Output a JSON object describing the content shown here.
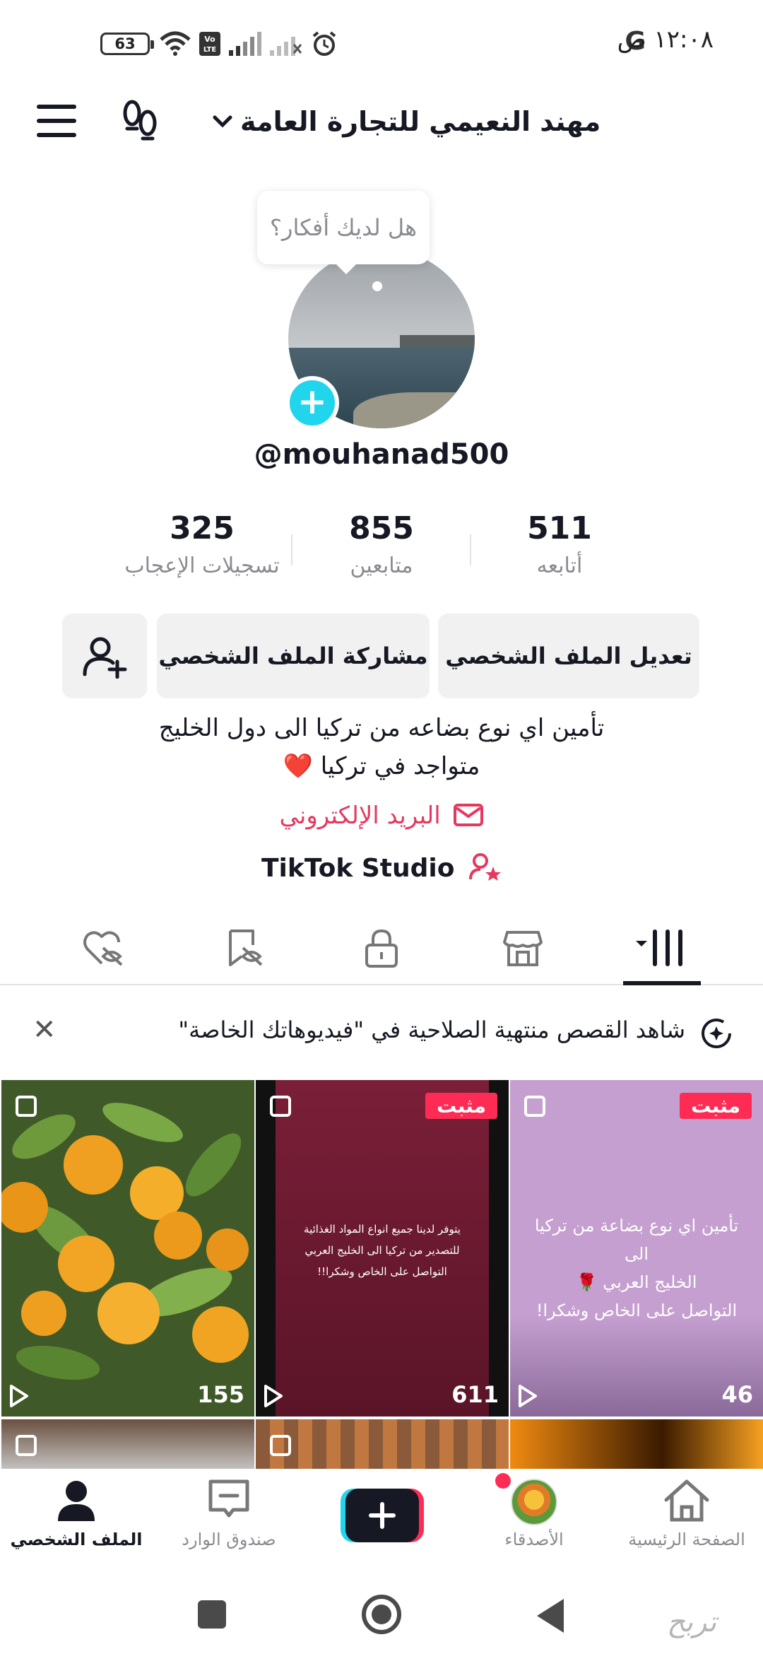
{
  "status_bar": {
    "battery": "63",
    "time": "١٢:٠٨ ص",
    "carrier_logo": "G",
    "icons": [
      "wifi-icon",
      "volte-icon",
      "signal-icon",
      "signal-2-icon",
      "alarm-icon"
    ]
  },
  "header": {
    "title": "مهند النعيمي للتجارة العامة",
    "icons": [
      "menu-icon",
      "footprint-icon",
      "chevron-down-icon"
    ]
  },
  "profile": {
    "bubble_text": "هل لديك أفكار؟",
    "username": "@mouhanad500",
    "stats": [
      {
        "value": "511",
        "label": "أتابعه"
      },
      {
        "value": "855",
        "label": "متابعين"
      },
      {
        "value": "325",
        "label": "تسجيلات الإعجاب"
      }
    ],
    "buttons": {
      "edit": "تعديل الملف الشخصي",
      "share": "مشاركة الملف الشخصي"
    },
    "bio_line1": "تأمين اي نوع بضاعه من تركيا الى دول الخليج",
    "bio_line2": "متواجد في تركيا ❤️",
    "email_link": "البريد الإلكتروني",
    "studio_link": "TikTok Studio"
  },
  "tabs": [
    "videos-tab",
    "shop-tab",
    "private-tab",
    "favorites-tab",
    "liked-tab"
  ],
  "banner": {
    "text": "شاهد القصص منتهية الصلاحية في \"فيديوهاتك الخاصة\""
  },
  "grid": [
    {
      "pinned_label": "مثبت",
      "text_lines": [
        "تأمين اي نوع بضاعة من تركيا الى",
        "الخليج العربي 🌹",
        "التواصل على الخاص وشكرا!"
      ],
      "views": "46",
      "background": "#c49fcf"
    },
    {
      "pinned_label": "مثبت",
      "text_lines": [
        "يتوفر لدينا جميع انواع المواد الغذائية",
        "للتصدير من تركيا الى الخليج العربي",
        "التواصل على الخاص وشكرا!!"
      ],
      "views": "611",
      "background": "#6e1c33"
    },
    {
      "views": "155",
      "background": "#5b7a35"
    }
  ],
  "bottom_nav": {
    "home": "الصفحة الرئيسية",
    "friends": "الأصدقاء",
    "inbox": "صندوق الوارد",
    "profile": "الملف الشخصي"
  },
  "system_nav": {
    "watermark": "تربح"
  },
  "colors": {
    "accent": "#fe2c55",
    "teal": "#20d5ec",
    "text": "#161823",
    "muted": "#8a8b91",
    "button_bg": "#f1f1f2",
    "email": "#e6385f"
  }
}
